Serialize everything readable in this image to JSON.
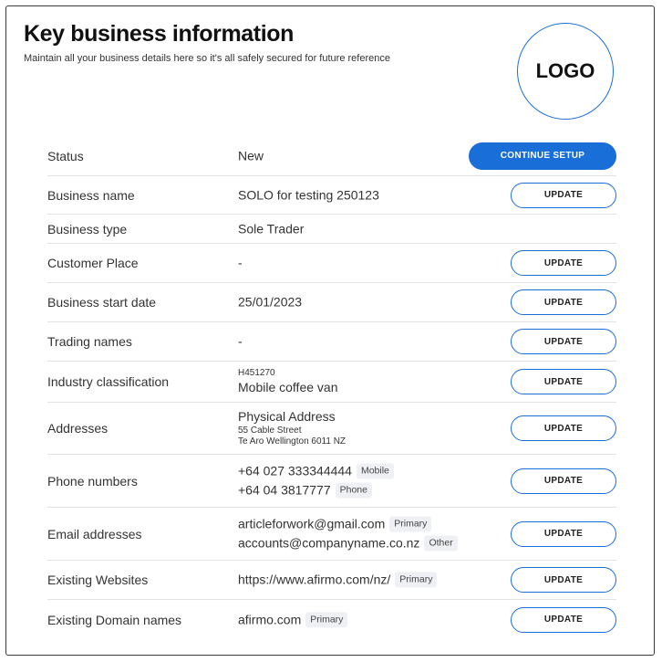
{
  "header": {
    "title": "Key business information",
    "subtitle": "Maintain all your business details here so it's all safely secured for future reference",
    "logo_text": "LOGO"
  },
  "buttons": {
    "update": "UPDATE",
    "continue_setup": "CONTINUE SETUP"
  },
  "rows": {
    "status": {
      "label": "Status",
      "value": "New"
    },
    "business_name": {
      "label": "Business name",
      "value": "SOLO for testing 250123"
    },
    "business_type": {
      "label": "Business type",
      "value": "Sole Trader"
    },
    "customer_place": {
      "label": "Customer Place",
      "value": "-"
    },
    "start_date": {
      "label": "Business start date",
      "value": "25/01/2023"
    },
    "trading_names": {
      "label": "Trading names",
      "value": "-"
    },
    "industry": {
      "label": "Industry classification",
      "code": "H451270",
      "value": "Mobile coffee van"
    },
    "addresses": {
      "label": "Addresses",
      "type": "Physical Address",
      "line1": "55 Cable Street",
      "line2": "Te Aro Wellington 6011 NZ"
    },
    "phones": {
      "label": "Phone numbers",
      "items": [
        {
          "number": "+64 027 333344444",
          "tag": "Mobile"
        },
        {
          "number": "+64 04 3817777",
          "tag": "Phone"
        }
      ]
    },
    "emails": {
      "label": "Email addresses",
      "items": [
        {
          "address": "articleforwork@gmail.com",
          "tag": "Primary"
        },
        {
          "address": "accounts@companyname.co.nz",
          "tag": "Other"
        }
      ]
    },
    "websites": {
      "label": "Existing Websites",
      "value": "https://www.afirmo.com/nz/",
      "tag": "Primary"
    },
    "domains": {
      "label": "Existing Domain names",
      "value": "afirmo.com",
      "tag": "Primary"
    }
  },
  "colors": {
    "accent": "#1a6ed8",
    "divider": "#e3e3e3",
    "tag_bg": "#eef0f3",
    "border": "#3a3a3a"
  }
}
